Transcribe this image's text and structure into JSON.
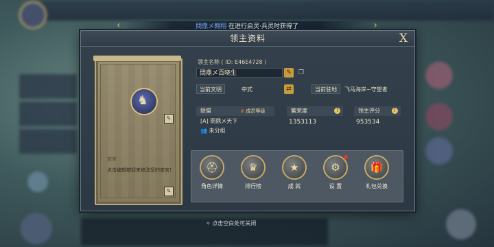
{
  "broadcast": {
    "player_name": "問鼎メ翱翔",
    "message": "在进行启灵·兵灵时获得了"
  },
  "panel": {
    "title": "领主资料",
    "close_glyph": "X"
  },
  "card": {
    "declaration_label": "宣言",
    "declaration_text": "点击编辑按钮来修改您的宣言!"
  },
  "profile": {
    "lord_name_label": "领主名称 ( ID: E46E4728 )",
    "lord_name_value": "問鼎メ百晓生",
    "civ_label": "当前文明",
    "civ_value": "中式",
    "garrison_label": "当前驻地",
    "garrison_value": "飞马海岸~守望者"
  },
  "alliance": {
    "header": "联盟",
    "member_rank_label": "成员等级",
    "name": "[A] 問鼎メ天下",
    "group": "未分组"
  },
  "prosperity": {
    "header": "繁荣度",
    "value": "1353113"
  },
  "rating": {
    "header": "领主评分",
    "value": "953534"
  },
  "actions": [
    {
      "label": "角色详情",
      "icon": "helmet-icon"
    },
    {
      "label": "排行榜",
      "icon": "trophy-icon"
    },
    {
      "label": "成 就",
      "icon": "star-icon"
    },
    {
      "label": "设 置",
      "icon": "gear-icon"
    },
    {
      "label": "礼包兑换",
      "icon": "gift-icon"
    }
  ],
  "hint": "点击空白处可关闭",
  "colors": {
    "accent": "#c79b3c",
    "notify": "#e23b2e",
    "link_name": "#7fb2ff"
  }
}
